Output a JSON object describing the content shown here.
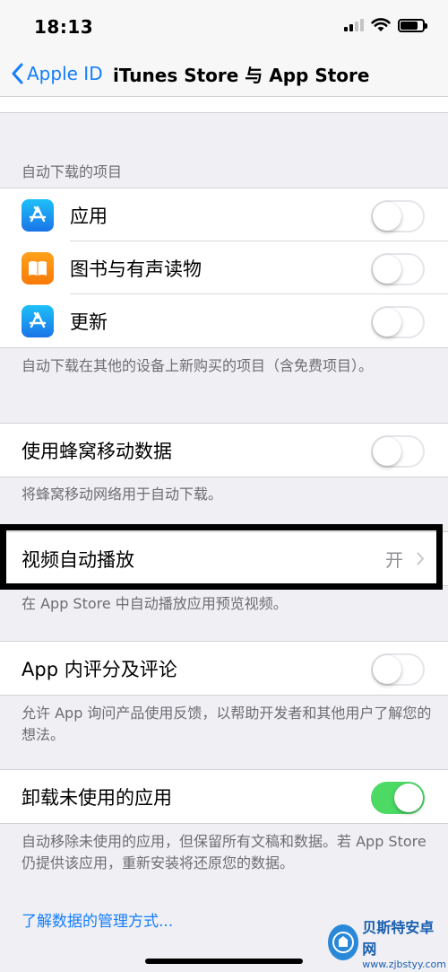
{
  "status_bar": {
    "time": "18:13"
  },
  "nav": {
    "back_label": "Apple ID",
    "title": "iTunes Store 与 App Store"
  },
  "auto_download": {
    "header": "自动下载的项目",
    "items": [
      {
        "label": "应用",
        "icon": "app-store-icon",
        "on": false
      },
      {
        "label": "图书与有声读物",
        "icon": "books-icon",
        "on": false
      },
      {
        "label": "更新",
        "icon": "app-store-icon",
        "on": false
      }
    ],
    "footer": "自动下载在其他的设备上新购买的项目（含免费项目）。"
  },
  "cellular": {
    "label": "使用蜂窝移动数据",
    "on": false,
    "footer": "将蜂窝移动网络用于自动下载。"
  },
  "video_autoplay": {
    "label": "视频自动播放",
    "value": "开",
    "footer": "在 App Store 中自动播放应用预览视频。"
  },
  "ratings": {
    "label": "App 内评分及评论",
    "on": false,
    "footer": "允许 App 询问产品使用反馈，以帮助开发者和其他用户了解您的想法。"
  },
  "offload": {
    "label": "卸载未使用的应用",
    "on": true,
    "footer": "自动移除未使用的应用，但保留所有文稿和数据。若 App Store 仍提供该应用，重新安装将还原您的数据。"
  },
  "link": {
    "label": "了解数据的管理方式..."
  },
  "watermark": {
    "name": "贝斯特安卓网",
    "url": "www.zjbstyy.com"
  },
  "colors": {
    "accent": "#157efb",
    "toggle_on": "#4cd964",
    "background": "#efeff4"
  }
}
